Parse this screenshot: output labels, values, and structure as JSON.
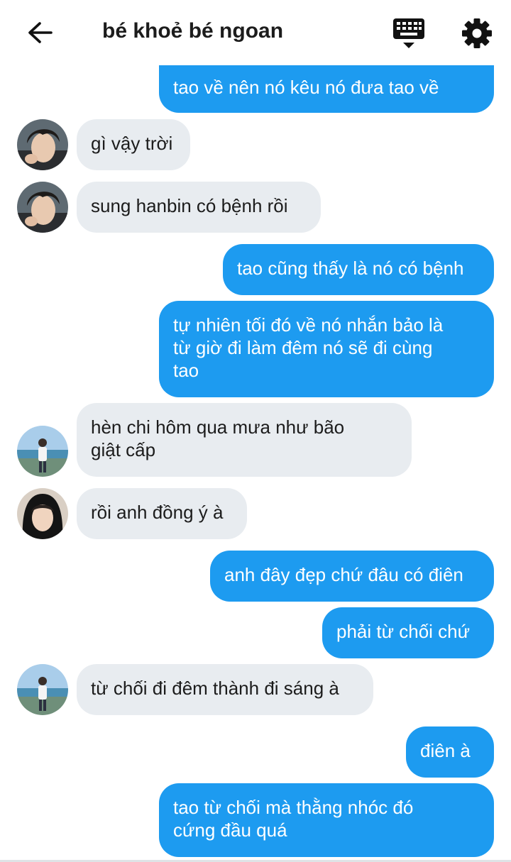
{
  "header": {
    "title": "bé khoẻ bé ngoan"
  },
  "colors": {
    "outgoing_bubble": "#1d9bf0",
    "incoming_bubble": "#e8ecf0"
  },
  "icons": {
    "back": "arrow-left-icon",
    "keyboard": "keyboard-icon",
    "settings": "gear-icon"
  },
  "messages": [
    {
      "side": "out",
      "text": "tao về nên nó kêu nó đưa tao về"
    },
    {
      "side": "in",
      "avatar": "avatar-dark-hair",
      "text": "gì vậy trời"
    },
    {
      "side": "in",
      "avatar": "avatar-dark-hair",
      "text": "sung hanbin có bệnh rồi"
    },
    {
      "side": "out",
      "text": "tao cũng thấy là nó có bệnh"
    },
    {
      "side": "out",
      "text": "tự nhiên tối đó về nó nhắn bảo là\ntừ giờ đi làm đêm nó sẽ đi cùng\ntao"
    },
    {
      "side": "in",
      "avatar": "avatar-beach",
      "text": "hèn chi hôm qua mưa như bão\ngiật cấp"
    },
    {
      "side": "in",
      "avatar": "avatar-hood",
      "text": "rồi anh đồng ý à"
    },
    {
      "side": "out",
      "text": "anh đây đẹp chứ đâu có điên"
    },
    {
      "side": "out",
      "text": "phải từ chối chứ"
    },
    {
      "side": "in",
      "avatar": "avatar-beach",
      "text": "từ chối đi đêm thành đi sáng à"
    },
    {
      "side": "out",
      "text": "điên à"
    },
    {
      "side": "out",
      "text": "tao từ chối mà thằng nhóc đó\ncứng đầu quá"
    }
  ]
}
